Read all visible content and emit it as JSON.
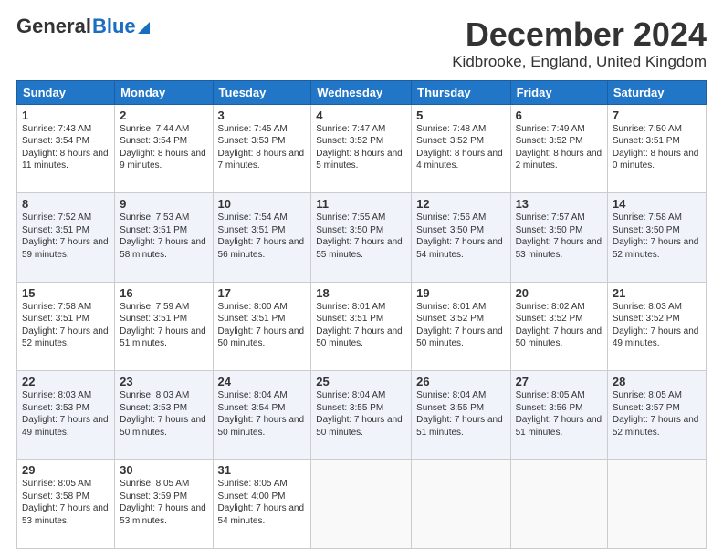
{
  "header": {
    "logo_general": "General",
    "logo_blue": "Blue",
    "main_title": "December 2024",
    "subtitle": "Kidbrooke, England, United Kingdom"
  },
  "calendar": {
    "days_of_week": [
      "Sunday",
      "Monday",
      "Tuesday",
      "Wednesday",
      "Thursday",
      "Friday",
      "Saturday"
    ],
    "weeks": [
      [
        {
          "day": "1",
          "sunrise": "7:43 AM",
          "sunset": "3:54 PM",
          "daylight": "8 hours and 11 minutes."
        },
        {
          "day": "2",
          "sunrise": "7:44 AM",
          "sunset": "3:54 PM",
          "daylight": "8 hours and 9 minutes."
        },
        {
          "day": "3",
          "sunrise": "7:45 AM",
          "sunset": "3:53 PM",
          "daylight": "8 hours and 7 minutes."
        },
        {
          "day": "4",
          "sunrise": "7:47 AM",
          "sunset": "3:52 PM",
          "daylight": "8 hours and 5 minutes."
        },
        {
          "day": "5",
          "sunrise": "7:48 AM",
          "sunset": "3:52 PM",
          "daylight": "8 hours and 4 minutes."
        },
        {
          "day": "6",
          "sunrise": "7:49 AM",
          "sunset": "3:52 PM",
          "daylight": "8 hours and 2 minutes."
        },
        {
          "day": "7",
          "sunrise": "7:50 AM",
          "sunset": "3:51 PM",
          "daylight": "8 hours and 0 minutes."
        }
      ],
      [
        {
          "day": "8",
          "sunrise": "7:52 AM",
          "sunset": "3:51 PM",
          "daylight": "7 hours and 59 minutes."
        },
        {
          "day": "9",
          "sunrise": "7:53 AM",
          "sunset": "3:51 PM",
          "daylight": "7 hours and 58 minutes."
        },
        {
          "day": "10",
          "sunrise": "7:54 AM",
          "sunset": "3:51 PM",
          "daylight": "7 hours and 56 minutes."
        },
        {
          "day": "11",
          "sunrise": "7:55 AM",
          "sunset": "3:50 PM",
          "daylight": "7 hours and 55 minutes."
        },
        {
          "day": "12",
          "sunrise": "7:56 AM",
          "sunset": "3:50 PM",
          "daylight": "7 hours and 54 minutes."
        },
        {
          "day": "13",
          "sunrise": "7:57 AM",
          "sunset": "3:50 PM",
          "daylight": "7 hours and 53 minutes."
        },
        {
          "day": "14",
          "sunrise": "7:58 AM",
          "sunset": "3:50 PM",
          "daylight": "7 hours and 52 minutes."
        }
      ],
      [
        {
          "day": "15",
          "sunrise": "7:58 AM",
          "sunset": "3:51 PM",
          "daylight": "7 hours and 52 minutes."
        },
        {
          "day": "16",
          "sunrise": "7:59 AM",
          "sunset": "3:51 PM",
          "daylight": "7 hours and 51 minutes."
        },
        {
          "day": "17",
          "sunrise": "8:00 AM",
          "sunset": "3:51 PM",
          "daylight": "7 hours and 50 minutes."
        },
        {
          "day": "18",
          "sunrise": "8:01 AM",
          "sunset": "3:51 PM",
          "daylight": "7 hours and 50 minutes."
        },
        {
          "day": "19",
          "sunrise": "8:01 AM",
          "sunset": "3:52 PM",
          "daylight": "7 hours and 50 minutes."
        },
        {
          "day": "20",
          "sunrise": "8:02 AM",
          "sunset": "3:52 PM",
          "daylight": "7 hours and 50 minutes."
        },
        {
          "day": "21",
          "sunrise": "8:03 AM",
          "sunset": "3:52 PM",
          "daylight": "7 hours and 49 minutes."
        }
      ],
      [
        {
          "day": "22",
          "sunrise": "8:03 AM",
          "sunset": "3:53 PM",
          "daylight": "7 hours and 49 minutes."
        },
        {
          "day": "23",
          "sunrise": "8:03 AM",
          "sunset": "3:53 PM",
          "daylight": "7 hours and 50 minutes."
        },
        {
          "day": "24",
          "sunrise": "8:04 AM",
          "sunset": "3:54 PM",
          "daylight": "7 hours and 50 minutes."
        },
        {
          "day": "25",
          "sunrise": "8:04 AM",
          "sunset": "3:55 PM",
          "daylight": "7 hours and 50 minutes."
        },
        {
          "day": "26",
          "sunrise": "8:04 AM",
          "sunset": "3:55 PM",
          "daylight": "7 hours and 51 minutes."
        },
        {
          "day": "27",
          "sunrise": "8:05 AM",
          "sunset": "3:56 PM",
          "daylight": "7 hours and 51 minutes."
        },
        {
          "day": "28",
          "sunrise": "8:05 AM",
          "sunset": "3:57 PM",
          "daylight": "7 hours and 52 minutes."
        }
      ],
      [
        {
          "day": "29",
          "sunrise": "8:05 AM",
          "sunset": "3:58 PM",
          "daylight": "7 hours and 53 minutes."
        },
        {
          "day": "30",
          "sunrise": "8:05 AM",
          "sunset": "3:59 PM",
          "daylight": "7 hours and 53 minutes."
        },
        {
          "day": "31",
          "sunrise": "8:05 AM",
          "sunset": "4:00 PM",
          "daylight": "7 hours and 54 minutes."
        },
        null,
        null,
        null,
        null
      ]
    ]
  }
}
